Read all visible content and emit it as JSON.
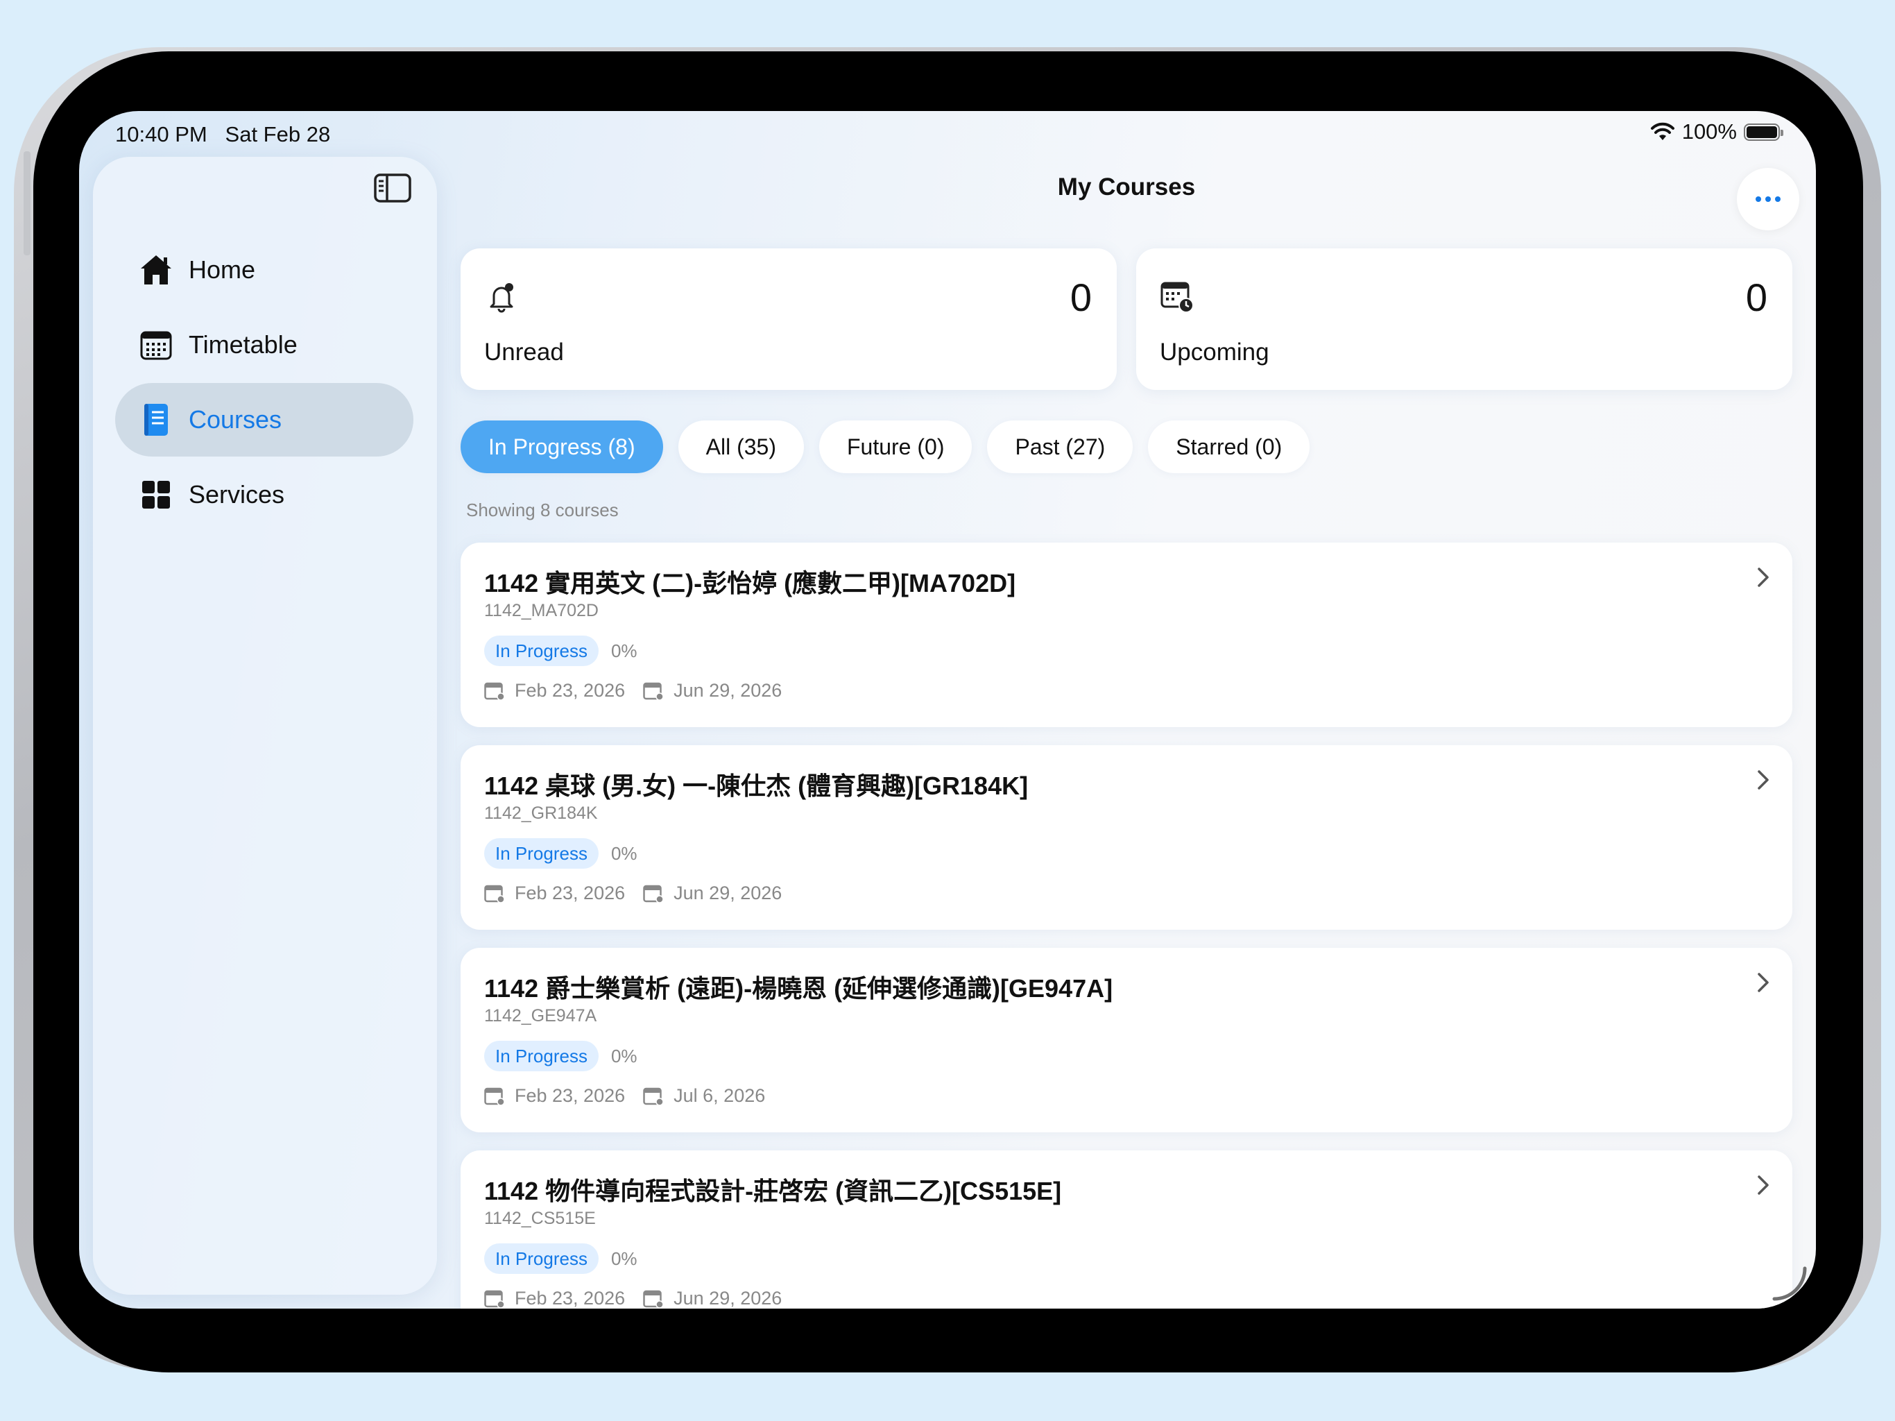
{
  "status_bar": {
    "time": "10:40 PM   Sat Feb 28",
    "battery": "100%"
  },
  "sidebar": {
    "items": [
      {
        "label": "Home",
        "icon": "house-icon"
      },
      {
        "label": "Timetable",
        "icon": "calendar-icon"
      },
      {
        "label": "Courses",
        "icon": "book-icon",
        "active": true
      },
      {
        "label": "Services",
        "icon": "grid-icon"
      }
    ]
  },
  "header": {
    "title": "My Courses"
  },
  "stats": {
    "unread": {
      "label": "Unread",
      "value": "0"
    },
    "upcoming": {
      "label": "Upcoming",
      "value": "0"
    }
  },
  "filters": [
    {
      "label": "In Progress (8)",
      "active": true
    },
    {
      "label": "All (35)"
    },
    {
      "label": "Future (0)"
    },
    {
      "label": "Past (27)"
    },
    {
      "label": "Starred (0)"
    }
  ],
  "showing": "Showing 8 courses",
  "courses": [
    {
      "title": "1142 實用英文 (二)-彭怡婷 (應數二甲)[MA702D]",
      "code": "1142_MA702D",
      "status": "In Progress",
      "progress": "0%",
      "start": "Feb 23, 2026",
      "end": "Jun 29, 2026"
    },
    {
      "title": "1142 桌球 (男.女) 一-陳仕杰 (體育興趣)[GR184K]",
      "code": "1142_GR184K",
      "status": "In Progress",
      "progress": "0%",
      "start": "Feb 23, 2026",
      "end": "Jun 29, 2026"
    },
    {
      "title": "1142 爵士樂賞析 (遠距)-楊曉恩 (延伸選修通識)[GE947A]",
      "code": "1142_GE947A",
      "status": "In Progress",
      "progress": "0%",
      "start": "Feb 23, 2026",
      "end": "Jul 6, 2026"
    },
    {
      "title": "1142 物件導向程式設計-莊啓宏 (資訊二乙)[CS515E]",
      "code": "1142_CS515E",
      "status": "In Progress",
      "progress": "0%",
      "start": "Feb 23, 2026",
      "end": "Jun 29, 2026"
    }
  ],
  "colors": {
    "accent": "#1479e6",
    "chip_active": "#4ea7f2",
    "badge_bg": "#e1efff"
  }
}
